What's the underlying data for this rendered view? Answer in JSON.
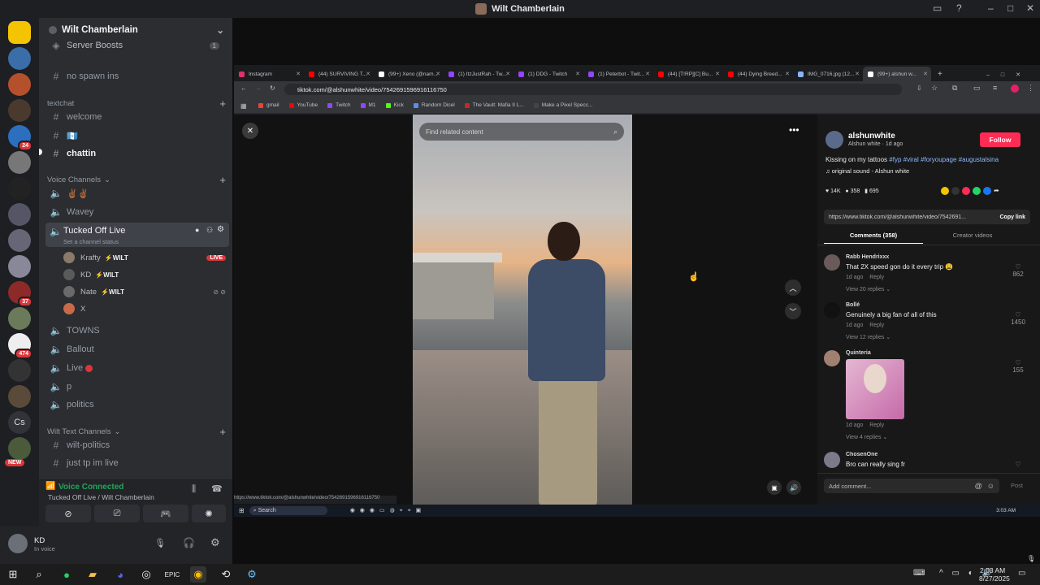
{
  "window": {
    "title": "Wilt Chamberlain"
  },
  "servers": {
    "badges": [
      "24",
      "37",
      "474"
    ],
    "cs_label": "Cs",
    "new_label": "NEW"
  },
  "discord": {
    "server_name": "Wilt Chamberlain",
    "server_boosts": "Server Boosts",
    "boost_count": "1",
    "no_spawn": "no spawn ins",
    "textchat_cat": "textchat",
    "welcome": "welcome",
    "flag_channel": "🇬🇹",
    "chattin": "chattin",
    "voice_cat": "Voice Channels",
    "vc1": "✌🏾✌🏾",
    "wavey": "Wavey",
    "tucked": "Tucked Off Live",
    "set_status": "Set a channel status",
    "users": [
      {
        "name": "Krafty",
        "tag": "⚡WILT",
        "live": "LIVE"
      },
      {
        "name": "KD",
        "tag": "⚡WILT"
      },
      {
        "name": "Nate",
        "tag": "⚡WILT"
      },
      {
        "name": "X",
        "tag": ""
      }
    ],
    "towns": "TOWNS",
    "ballout": "Ballout",
    "live": "Live",
    "p": "p",
    "politics": "politics",
    "wilt_text_cat": "Wilt Text Channels",
    "wilt_politics": "wilt-politics",
    "just_tp": "just tp im live",
    "vc_connected": "Voice Connected",
    "vc_where": "Tucked Off Live / Wilt Chamberlain",
    "me_name": "KD",
    "me_status": "In voice"
  },
  "browser": {
    "tabs": [
      {
        "label": "Instagram",
        "color": "#e1306c"
      },
      {
        "label": "(44) SURVIVING T...",
        "color": "#ff0000"
      },
      {
        "label": "(99+) Xeno (@nam...",
        "color": "#ffffff"
      },
      {
        "label": "(1) ItzJustRah - Tw...",
        "color": "#9146ff"
      },
      {
        "label": "(1) DDG - Twitch",
        "color": "#9146ff"
      },
      {
        "label": "(1) Peterbot - Twit...",
        "color": "#9146ff"
      },
      {
        "label": "(44) [T!RP][C] Bu...",
        "color": "#ff0000"
      },
      {
        "label": "(44) Dying Breed...",
        "color": "#ff0000"
      },
      {
        "label": "IMG_0716.jpg (12...",
        "color": "#8ab4f8"
      },
      {
        "label": "(99+) alshun w...",
        "color": "#ffffff"
      }
    ],
    "url": "tiktok.com/@alshunwhite/video/7542691596916116750",
    "bookmarks": [
      {
        "label": "gmail",
        "color": "#ea4335"
      },
      {
        "label": "YouTube",
        "color": "#ff0000"
      },
      {
        "label": "Twitch",
        "color": "#9146ff"
      },
      {
        "label": "M1",
        "color": "#9146ff"
      },
      {
        "label": "Kick",
        "color": "#53fc18"
      },
      {
        "label": "Random Dicel",
        "color": "#5b8def"
      },
      {
        "label": "The Vault: Mafia II L...",
        "color": "#c62828"
      },
      {
        "label": "Make a Pixel Specc...",
        "color": "#444"
      }
    ],
    "status_url": "https://www.tiktok.com/@alshunwhite/video/7542691596916116750",
    "inner_search": "Search",
    "inner_clock": "3:03 AM"
  },
  "tiktok": {
    "find_placeholder": "Find related content",
    "username": "alshunwhite",
    "subtitle": "Alshun white · 1d ago",
    "follow": "Follow",
    "caption": "Kissing on my tattoos",
    "hashtags": "#fyp #viral #foryoupage #augustalsina",
    "sound": "original sound - Alshun white",
    "likes": "14K",
    "comments_count": "358",
    "saves": "695",
    "link": "https://www.tiktok.com/@alshunwhite/video/7542691...",
    "copy_link": "Copy link",
    "tab_comments": "Comments (358)",
    "tab_creator": "Creator videos",
    "comments": [
      {
        "name": "Rabb Hendrixxx",
        "text": "That 2X speed gon do it every trip 😩",
        "time": "1d ago",
        "reply": "Reply",
        "likes": "862",
        "view": "View 20 replies"
      },
      {
        "name": "Bollé",
        "text": "Genuinely a big fan of all of this",
        "time": "1d ago",
        "reply": "Reply",
        "likes": "1450",
        "view": "View 12 replies"
      },
      {
        "name": "Quinteria",
        "text": "",
        "time": "1d ago",
        "reply": "Reply",
        "likes": "155",
        "view": "View 4 replies"
      },
      {
        "name": "ChosenOne",
        "text": "Bro can really sing fr",
        "time": "",
        "reply": "",
        "likes": "",
        "view": ""
      }
    ],
    "add_comment": "Add comment...",
    "post": "Post"
  },
  "taskbar": {
    "time": "2:03 AM",
    "date": "8/27/2025"
  },
  "colors": {
    "accent_pink": "#fe2c55",
    "discord_green": "#23a55a",
    "live_red": "#da373c"
  }
}
